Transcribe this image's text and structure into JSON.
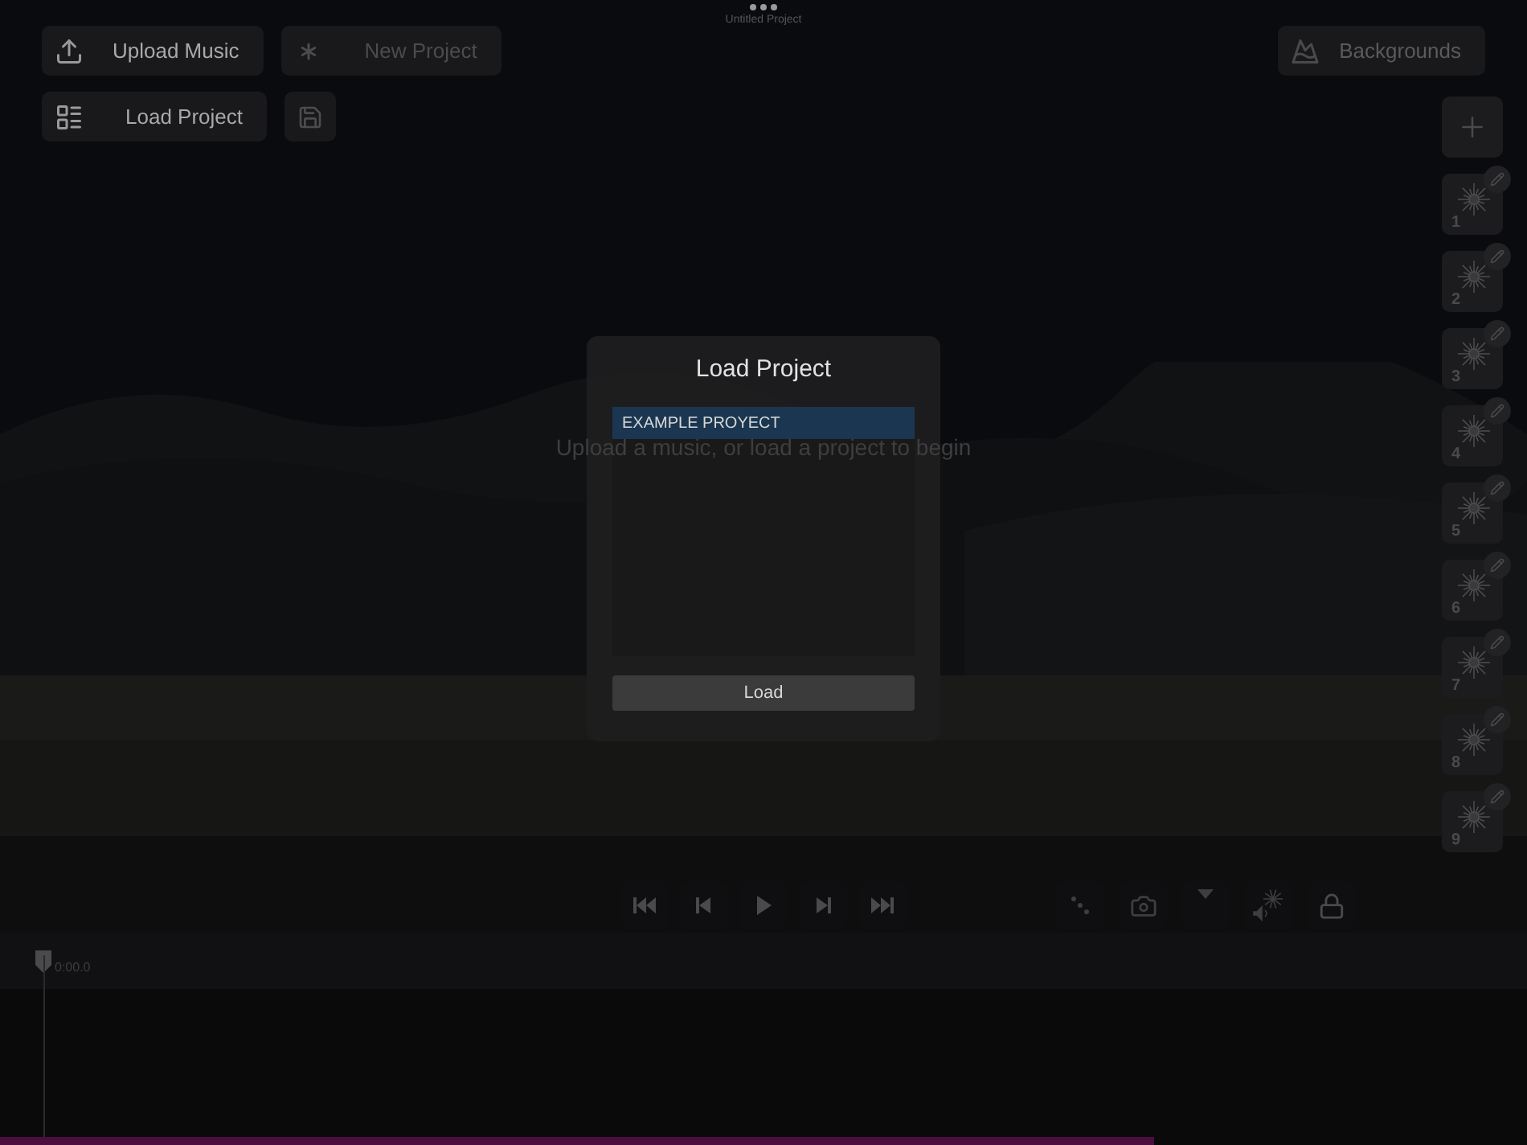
{
  "header": {
    "project_title": "Untitled Project"
  },
  "toolbar": {
    "rows": [
      [
        {
          "kind": "upload",
          "label": "Upload Music",
          "disabled": false
        },
        {
          "kind": "asterisk",
          "label": "New Project",
          "disabled": true
        }
      ],
      [
        {
          "kind": "list",
          "label": "Load Project",
          "disabled": false
        },
        {
          "kind": "save",
          "disabled": true
        }
      ]
    ]
  },
  "backgrounds_button": {
    "label": "Backgrounds"
  },
  "presets": [
    {
      "number": "1"
    },
    {
      "number": "2"
    },
    {
      "number": "3"
    },
    {
      "number": "4"
    },
    {
      "number": "5"
    },
    {
      "number": "6"
    },
    {
      "number": "7"
    },
    {
      "number": "8"
    },
    {
      "number": "9"
    }
  ],
  "message": "Upload a music, or load a project to begin",
  "transport": [
    {
      "kind": "first"
    },
    {
      "kind": "previous"
    },
    {
      "kind": "play"
    },
    {
      "kind": "next"
    },
    {
      "kind": "last"
    }
  ],
  "tools": [
    {
      "kind": "connect"
    },
    {
      "kind": "camera"
    },
    {
      "kind": "dropdown"
    },
    {
      "kind": "audio"
    },
    {
      "kind": "lock"
    }
  ],
  "timeline": {
    "time": "0:00.0",
    "level": 0.756
  },
  "dialog": {
    "title": "Load Project",
    "projects": [
      {
        "name": "EXAMPLE PROYECT",
        "selected": true
      }
    ],
    "button": "Load"
  }
}
